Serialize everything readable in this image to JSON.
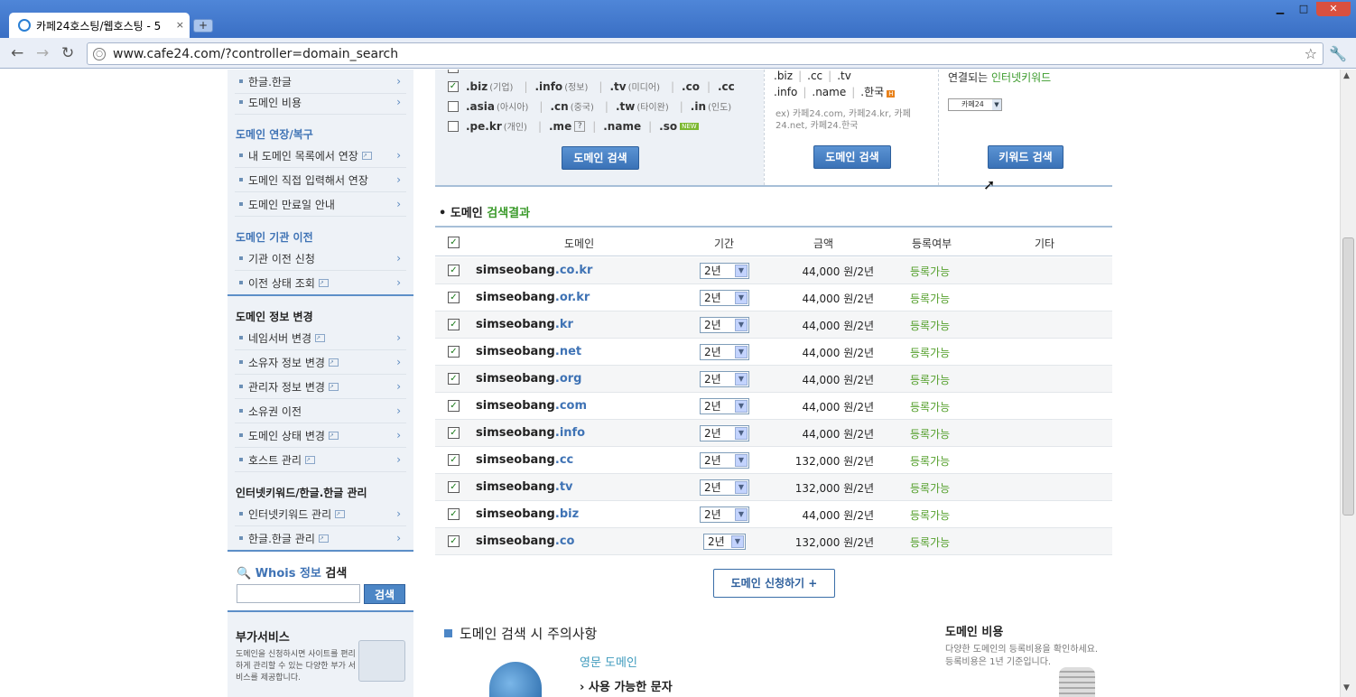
{
  "browser": {
    "tab_title": "카페24호스팅/웹호스팅 - 5",
    "tab_close": "×",
    "new_tab": "+",
    "url": "www.cafe24.com/?controller=domain_search",
    "win_min": "▁",
    "win_max": "□",
    "win_close": "✕"
  },
  "sidebar": {
    "top_items": [
      {
        "label": "한글.한글"
      },
      {
        "label": "도메인 비용"
      }
    ],
    "renew_heading": "도메인 연장/복구",
    "renew_items": [
      {
        "label": "내 도메인 목록에서 연장",
        "ext": true
      },
      {
        "label": "도메인 직접 입력해서 연장"
      },
      {
        "label": "도메인 만료일 안내"
      }
    ],
    "transfer_heading": "도메인 기관 이전",
    "transfer_items": [
      {
        "label": "기관 이전 신청"
      },
      {
        "label": "이전 상태 조회",
        "ext": true
      }
    ],
    "info_heading": "도메인 정보 변경",
    "info_items": [
      {
        "label": "네임서버 변경",
        "ext": true
      },
      {
        "label": "소유자 정보 변경",
        "ext": true
      },
      {
        "label": "관리자 정보 변경",
        "ext": true
      },
      {
        "label": "소유권 이전"
      },
      {
        "label": "도메인 상태 변경",
        "ext": true
      },
      {
        "label": "호스트 관리",
        "ext": true
      }
    ],
    "kw_heading": "인터넷키워드/한글.한글 관리",
    "kw_items": [
      {
        "label": "인터넷키워드 관리",
        "ext": true
      },
      {
        "label": "한글.한글 관리",
        "ext": true
      }
    ],
    "whois": {
      "title_blue": "Whois 정보",
      "title_dark": " 검색",
      "button": "검색",
      "value": ""
    },
    "addon": {
      "title": "부가서비스",
      "desc": "도메인을 신청하시면 사이트를 편리하게 관리할 수 있는 다양한 부가 서비스를 제공합니다."
    }
  },
  "search_panel": {
    "tld_rows": [
      [
        {
          "name": ".biz",
          "sub": "(기업)",
          "checked": true
        },
        {
          "name": ".info",
          "sub": "(정보)"
        },
        {
          "name": ".tv",
          "sub": "(미디어)"
        },
        {
          "name": ".co"
        },
        {
          "name": ".cc"
        }
      ],
      [
        {
          "name": ".asia",
          "sub": "(아시아)",
          "checked": false
        },
        {
          "name": ".cn",
          "sub": "(중국)"
        },
        {
          "name": ".tw",
          "sub": "(타이완)"
        },
        {
          "name": ".in",
          "sub": "(인도)"
        }
      ],
      [
        {
          "name": ".pe.kr",
          "sub": "(개인)",
          "checked": false
        },
        {
          "name": ".me",
          "q": "?"
        },
        {
          "name": ".name"
        },
        {
          "name": ".so",
          "badge": "NEW"
        }
      ]
    ],
    "search_button": "도메인 검색",
    "mid_line1": [
      ".biz",
      ".cc",
      ".tv"
    ],
    "mid_line2": [
      ".info",
      ".name",
      ".한국"
    ],
    "mid_badge": "H",
    "mid_example": "ex) 카페24.com, 카페24.kr, 카페24.net, 카페24.한국",
    "mid_button": "도메인 검색",
    "right_title_prefix": "연결되는 ",
    "right_title_link": "인터넷키워드",
    "kw_select": "카페24",
    "right_button": "키워드 검색"
  },
  "results": {
    "title_prefix": "도메인 ",
    "title_highlight": "검색결과",
    "headers": {
      "domain": "도메인",
      "period": "기간",
      "price": "금액",
      "status": "등록여부",
      "etc": "기타"
    },
    "rows": [
      {
        "base": "simseobang",
        "tld": ".co.kr",
        "period": "2년",
        "price": "44,000 원/2년",
        "status": "등록가능"
      },
      {
        "base": "simseobang",
        "tld": ".or.kr",
        "period": "2년",
        "price": "44,000 원/2년",
        "status": "등록가능"
      },
      {
        "base": "simseobang",
        "tld": ".kr",
        "period": "2년",
        "price": "44,000 원/2년",
        "status": "등록가능"
      },
      {
        "base": "simseobang",
        "tld": ".net",
        "period": "2년",
        "price": "44,000 원/2년",
        "status": "등록가능"
      },
      {
        "base": "simseobang",
        "tld": ".org",
        "period": "2년",
        "price": "44,000 원/2년",
        "status": "등록가능"
      },
      {
        "base": "simseobang",
        "tld": ".com",
        "period": "2년",
        "price": "44,000 원/2년",
        "status": "등록가능"
      },
      {
        "base": "simseobang",
        "tld": ".info",
        "period": "2년",
        "price": "44,000 원/2년",
        "status": "등록가능"
      },
      {
        "base": "simseobang",
        "tld": ".cc",
        "period": "2년",
        "price": "132,000 원/2년",
        "status": "등록가능"
      },
      {
        "base": "simseobang",
        "tld": ".tv",
        "period": "2년",
        "price": "132,000 원/2년",
        "status": "등록가능"
      },
      {
        "base": "simseobang",
        "tld": ".biz",
        "period": "2년",
        "price": "44,000 원/2년",
        "status": "등록가능"
      },
      {
        "base": "simseobang",
        "tld": ".co",
        "period": "2년",
        "price": "132,000 원/2년",
        "status": "등록가능"
      }
    ],
    "apply_button": "도메인 신청하기 +"
  },
  "bottom": {
    "notice_title": "도메인 검색 시 주의사항",
    "eng_domain": "영문 도메인",
    "usable_chars": "› 사용 가능한 문자",
    "cost_title": "도메인 비용",
    "cost_desc": "다양한 도메인의 등록비용을 확인하세요. 등록비용은 1년 기준입니다."
  }
}
